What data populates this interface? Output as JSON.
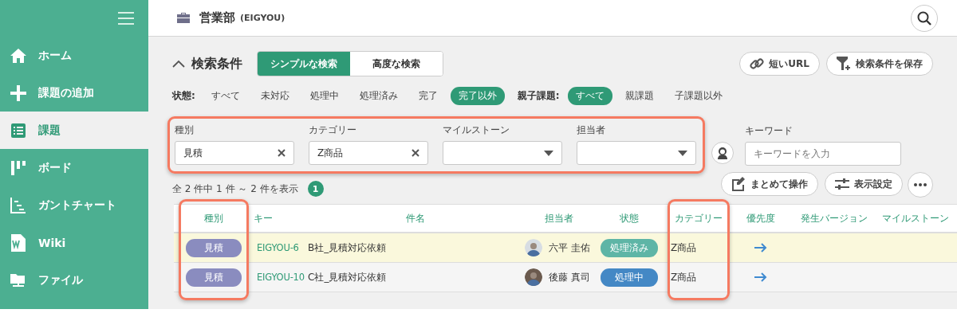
{
  "sidebar": {
    "items": [
      {
        "label": "ホーム",
        "selected": false
      },
      {
        "label": "課題の追加",
        "selected": false
      },
      {
        "label": "課題",
        "selected": true
      },
      {
        "label": "ボード",
        "selected": false
      },
      {
        "label": "ガントチャート",
        "selected": false
      },
      {
        "label": "Wiki",
        "selected": false
      },
      {
        "label": "ファイル",
        "selected": false
      }
    ]
  },
  "header": {
    "project": "営業部",
    "project_key": "(EIGYOU)"
  },
  "search": {
    "title": "検索条件",
    "expanded": true,
    "modes": [
      {
        "label": "シンプルな検索",
        "selected": true
      },
      {
        "label": "高度な検索",
        "selected": false
      }
    ],
    "buttons": [
      "短いURL",
      "検索条件を保存"
    ]
  },
  "status_filter": {
    "label": "状態:",
    "options": [
      {
        "label": "すべて",
        "selected": false
      },
      {
        "label": "未対応",
        "selected": false
      },
      {
        "label": "処理中",
        "selected": false
      },
      {
        "label": "処理済み",
        "selected": false
      },
      {
        "label": "完了",
        "selected": false
      },
      {
        "label": "完了以外",
        "selected": true
      }
    ]
  },
  "parent_filter": {
    "label": "親子課題:",
    "options": [
      {
        "label": "すべて",
        "selected": true
      },
      {
        "label": "親課題",
        "selected": false
      },
      {
        "label": "子課題以外",
        "selected": false
      }
    ]
  },
  "filters": {
    "highlighted": true,
    "fields": [
      {
        "kind": "clearable",
        "label": "種別",
        "value": "見積"
      },
      {
        "kind": "clearable",
        "label": "カテゴリー",
        "value": "Z商品"
      },
      {
        "kind": "dropdown",
        "label": "マイルストーン"
      },
      {
        "kind": "dropdown",
        "label": "担当者"
      }
    ]
  },
  "keyword": {
    "label": "キーワード",
    "placeholder": "キーワードを入力"
  },
  "result_count": "全 2 件中 1 件 ～ 2 件を表示",
  "page": "1",
  "actions": [
    "まとめて操作",
    "表示設定"
  ],
  "table": {
    "columns": [
      {
        "label": "種別",
        "highlighted": true
      },
      {
        "label": "キー",
        "highlighted": false
      },
      {
        "label": "件名",
        "highlighted": false
      },
      {
        "label": "担当者",
        "highlighted": false
      },
      {
        "label": "状態",
        "highlighted": false
      },
      {
        "label": "カテゴリー",
        "highlighted": true
      },
      {
        "label": "優先度",
        "highlighted": false
      },
      {
        "label": "発生バージョン",
        "highlighted": false
      },
      {
        "label": "マイルストーン",
        "highlighted": false
      }
    ],
    "rows": [
      {
        "selected": true,
        "type": "見積",
        "key": "EIGYOU-6",
        "subject": "B社_見積対応依頼",
        "assignee": "六平 圭佑",
        "status": {
          "label": "処理済み",
          "color": "#5eb5a6"
        },
        "category": "Z商品"
      },
      {
        "selected": false,
        "type": "見積",
        "key": "EIGYOU-10",
        "subject": "C社_見積対応依頼",
        "assignee": "後藤 真司",
        "status": {
          "label": "処理中",
          "color": "#4488c5"
        },
        "category": "Z商品"
      }
    ]
  }
}
